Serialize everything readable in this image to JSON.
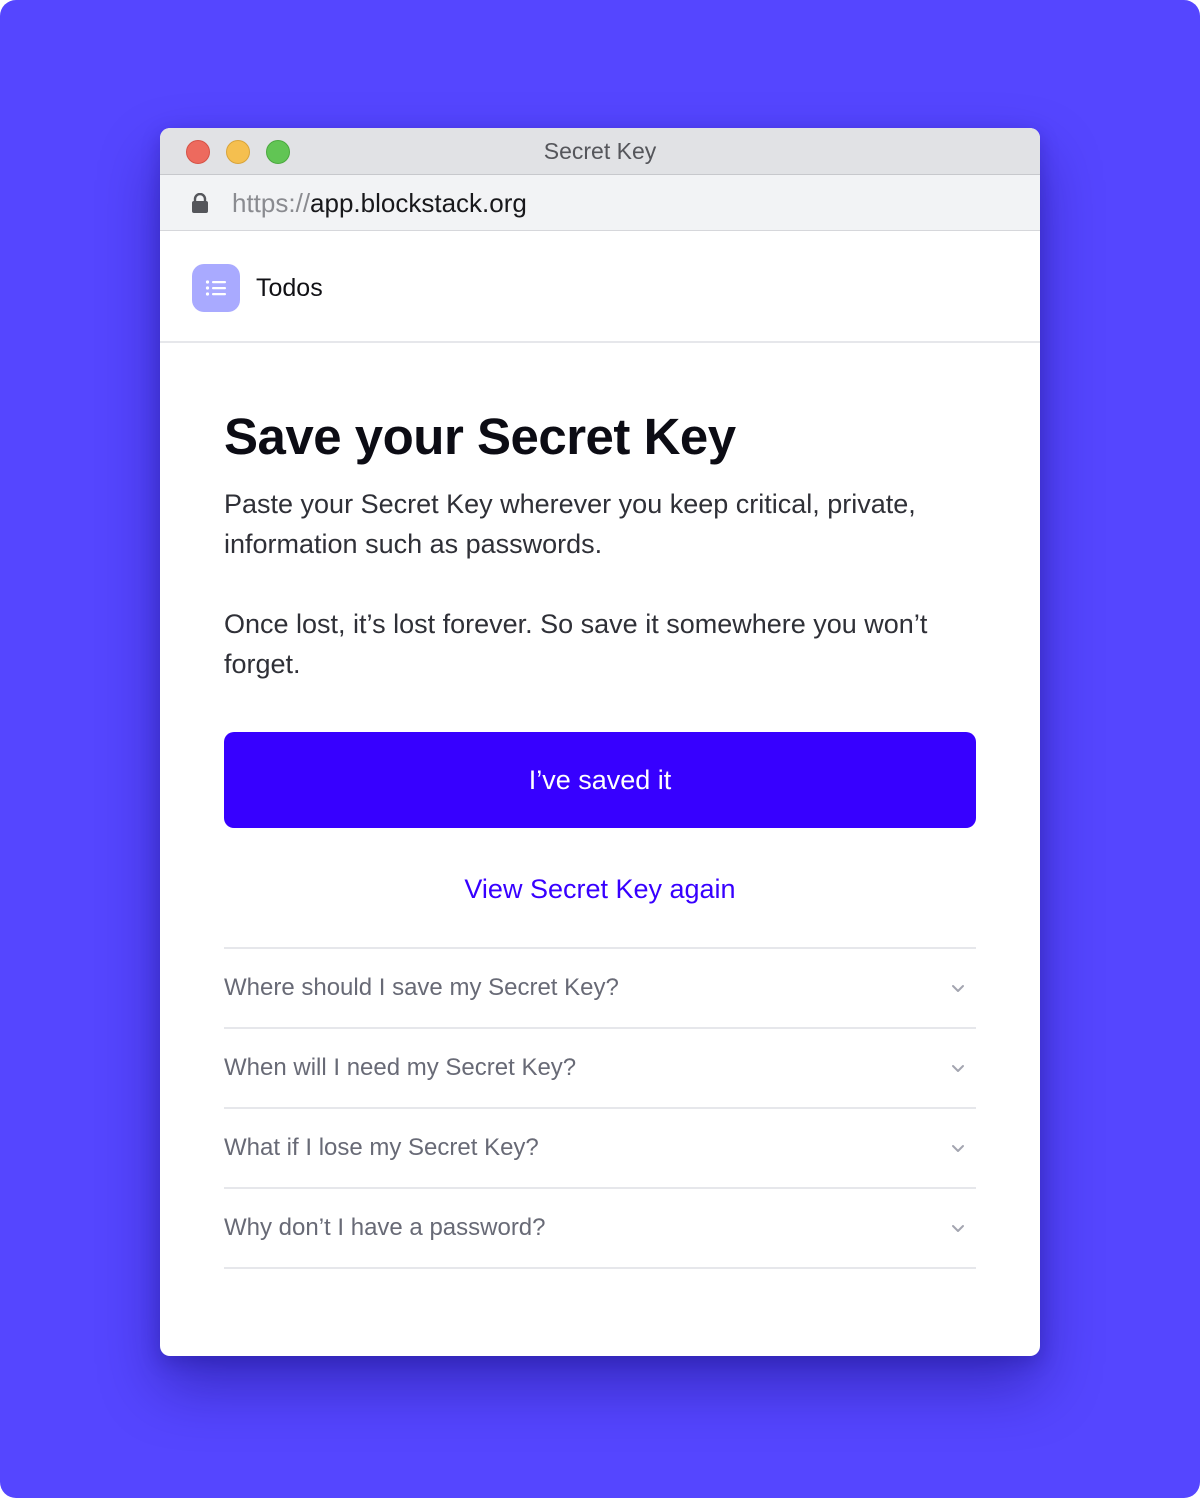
{
  "window": {
    "title": "Secret Key",
    "url_scheme": "https://",
    "url_host": "app.blockstack.org"
  },
  "app": {
    "name": "Todos",
    "icon": "list-icon"
  },
  "main": {
    "heading": "Save your Secret Key",
    "paragraph_1": "Paste your Secret Key wherever you keep critical, private, information such as passwords.",
    "paragraph_2": "Once lost, it’s lost forever. So save it somewhere you won’t forget.",
    "primary_button": "I’ve saved it",
    "secondary_link": "View Secret Key again"
  },
  "faq": [
    {
      "question": "Where should I save my Secret Key?"
    },
    {
      "question": "When will I need my Secret Key?"
    },
    {
      "question": "What if I lose my Secret Key?"
    },
    {
      "question": "Why don’t I have a password?"
    }
  ],
  "colors": {
    "background": "#5546ff",
    "accent": "#3700ff",
    "app_icon_bg": "#a9aaff"
  }
}
